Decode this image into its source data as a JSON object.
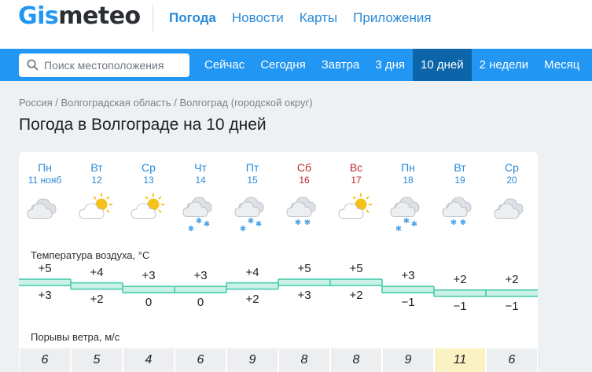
{
  "logo": {
    "part1": "Gis",
    "part2": "meteo"
  },
  "topnav": [
    "Погода",
    "Новости",
    "Карты",
    "Приложения"
  ],
  "search": {
    "placeholder": "Поиск местоположения"
  },
  "tabs": [
    "Сейчас",
    "Сегодня",
    "Завтра",
    "3 дня",
    "10 дней",
    "2 недели",
    "Месяц"
  ],
  "active_tab": "10 дней",
  "breadcrumb": "Россия / Волгоградская область / Волгоград (городской округ)",
  "title": "Погода в Волгограде на 10 дней",
  "days": [
    {
      "dow": "Пн",
      "date": "11 нояб",
      "icon": "cloudy",
      "weekend": false
    },
    {
      "dow": "Вт",
      "date": "12",
      "icon": "partly-cloudy",
      "weekend": false
    },
    {
      "dow": "Ср",
      "date": "13",
      "icon": "partly-cloudy",
      "weekend": false
    },
    {
      "dow": "Чт",
      "date": "14",
      "icon": "cloudy-snow",
      "weekend": false
    },
    {
      "dow": "Пт",
      "date": "15",
      "icon": "cloudy-snow",
      "weekend": false
    },
    {
      "dow": "Сб",
      "date": "16",
      "icon": "cloudy-light-snow",
      "weekend": true
    },
    {
      "dow": "Вс",
      "date": "17",
      "icon": "partly-cloudy",
      "weekend": true
    },
    {
      "dow": "Пн",
      "date": "18",
      "icon": "cloudy-snow",
      "weekend": false
    },
    {
      "dow": "Вт",
      "date": "19",
      "icon": "cloudy-light-snow",
      "weekend": false
    },
    {
      "dow": "Ср",
      "date": "20",
      "icon": "cloudy",
      "weekend": false
    }
  ],
  "temperature": {
    "label": "Температура воздуха, °C",
    "max": [
      "+5",
      "+4",
      "+3",
      "+3",
      "+4",
      "+5",
      "+5",
      "+3",
      "+2",
      "+2"
    ],
    "min": [
      "+3",
      "+2",
      "0",
      "0",
      "+2",
      "+3",
      "+2",
      "−1",
      "−1",
      "−1"
    ],
    "band_color": "#c9f1e6",
    "line_color": "#3fc9a6"
  },
  "wind": {
    "label": "Порывы ветра, м/с",
    "gusts": [
      "6",
      "5",
      "4",
      "6",
      "9",
      "8",
      "8",
      "9",
      "11",
      "6"
    ],
    "highlight_index": 8
  },
  "colors": {
    "brand": "#2196f3",
    "active_tab": "#0d65a9",
    "weekend": "#c0272d"
  }
}
